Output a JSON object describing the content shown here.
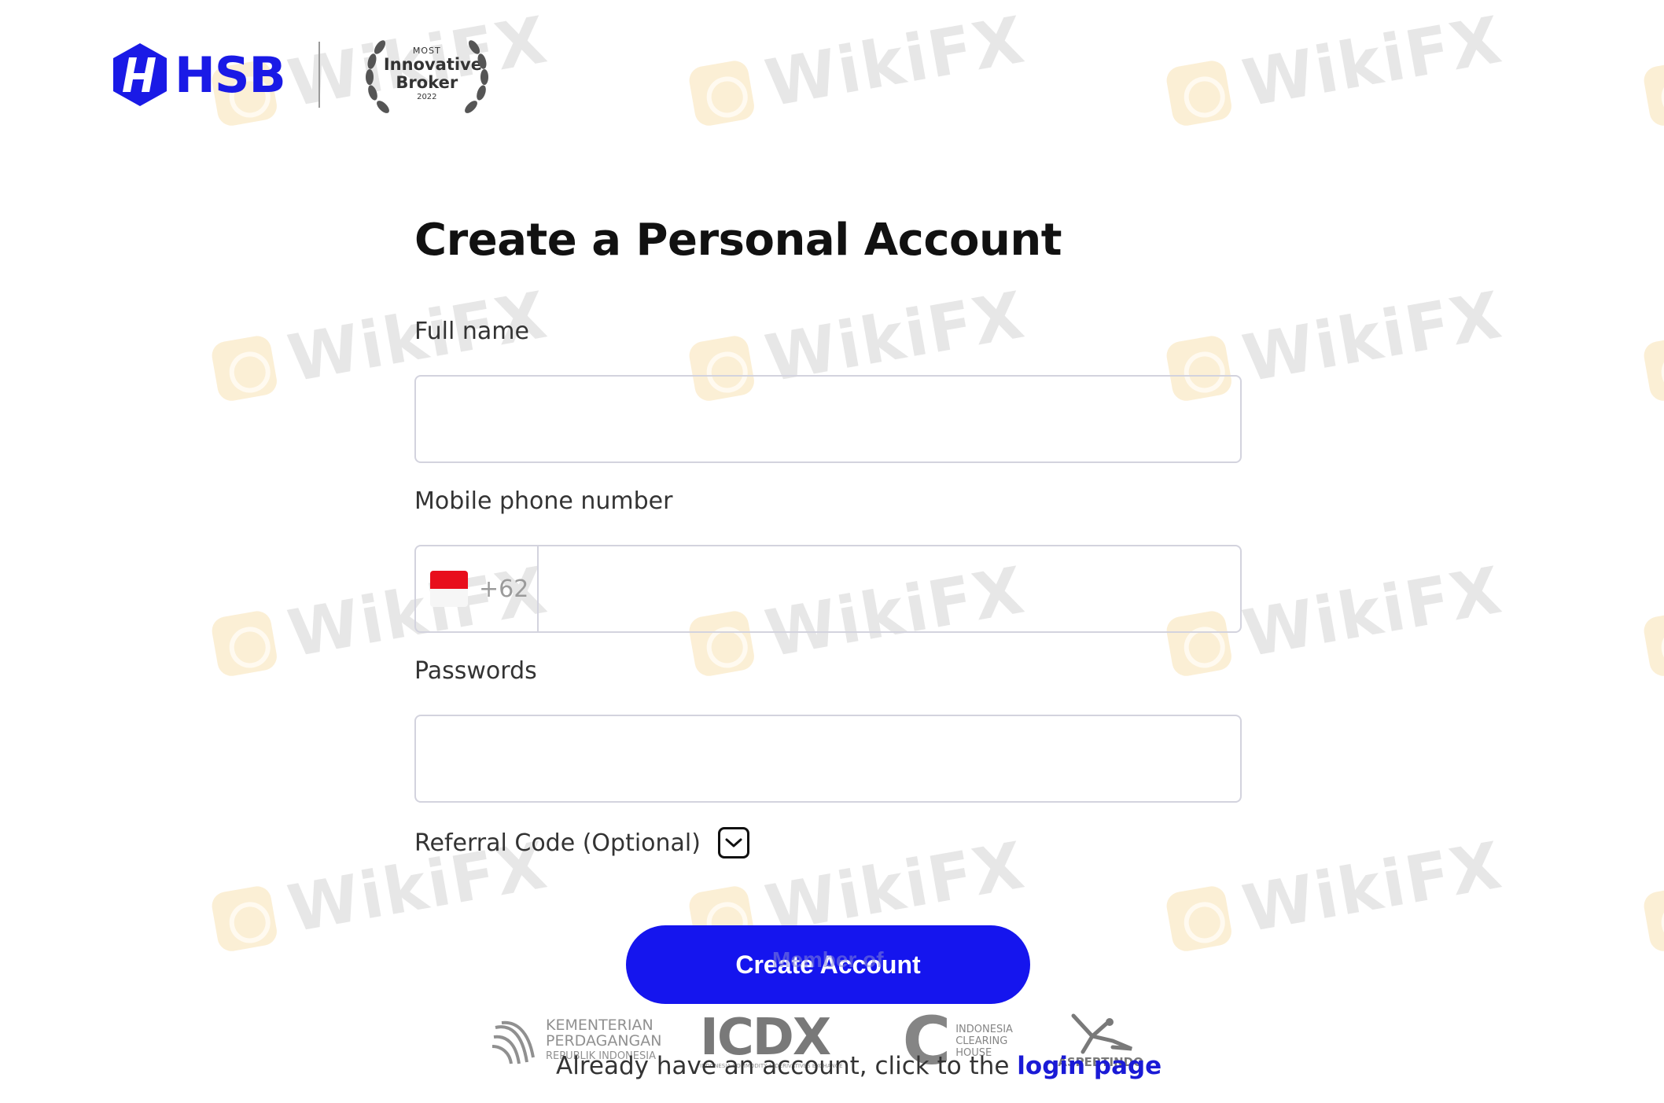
{
  "watermark": {
    "text": "WikiFX"
  },
  "header": {
    "brand": "HSB",
    "award": {
      "top": "MOST",
      "main": "Innovative Broker",
      "year": "2022"
    }
  },
  "form": {
    "title": "Create a Personal Account",
    "full_name": {
      "label": "Full name",
      "value": "",
      "placeholder": ""
    },
    "phone": {
      "label": "Mobile phone number",
      "country_code": "+62",
      "value": "",
      "placeholder": ""
    },
    "password": {
      "label": "Passwords",
      "value": "",
      "placeholder": ""
    },
    "referral": {
      "label": "Referral Code (Optional)",
      "expanded": false
    },
    "submit_label": "Create Account"
  },
  "members": {
    "heading": "Member of",
    "partners": [
      {
        "name": "KEMENTERIAN PERDAGANGAN",
        "sub": "REPUBLIK INDONESIA"
      },
      {
        "name": "ICDX",
        "sub": "INDONESIA COMMODITY & DERIVATIVES EXCHANGE"
      },
      {
        "name": "INDONESIA CLEARING HOUSE",
        "sub": ""
      },
      {
        "name": "ASPEBTINDO",
        "sub": ""
      }
    ]
  },
  "footer": {
    "login_prompt": "Already have an account, click to the ",
    "login_link": "login page"
  },
  "colors": {
    "accent": "#1515ee",
    "border": "#d3d3de",
    "flag_red": "#e80e1c"
  }
}
